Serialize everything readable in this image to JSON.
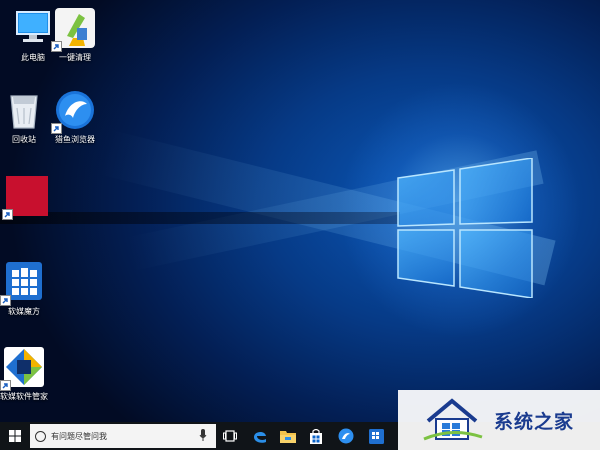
{
  "desktop": {
    "icons": [
      {
        "label": "此电脑",
        "icon": "this-pc-icon"
      },
      {
        "label": "一键清理",
        "icon": "one-click-clean-icon"
      },
      {
        "label": "回收站",
        "icon": "recycle-bin-icon"
      },
      {
        "label": "猎鱼浏览器",
        "icon": "browser-icon"
      },
      {
        "label": "",
        "icon": "red-tile-icon"
      },
      {
        "label": "软媒魔方",
        "icon": "ruanmei-cube-icon"
      },
      {
        "label": "软媒软件管家",
        "icon": "software-manager-icon"
      }
    ]
  },
  "taskbar": {
    "search_placeholder": "有问题尽管问我",
    "icons": [
      "task-view-icon",
      "edge-icon",
      "file-explorer-icon",
      "store-icon",
      "browser-taskbar-icon",
      "cube-taskbar-icon"
    ]
  },
  "watermark": {
    "text": "系统之家"
  },
  "colors": {
    "accent": "#0a63c9",
    "taskbar": "#101418",
    "red_tile": "#c8102e"
  }
}
